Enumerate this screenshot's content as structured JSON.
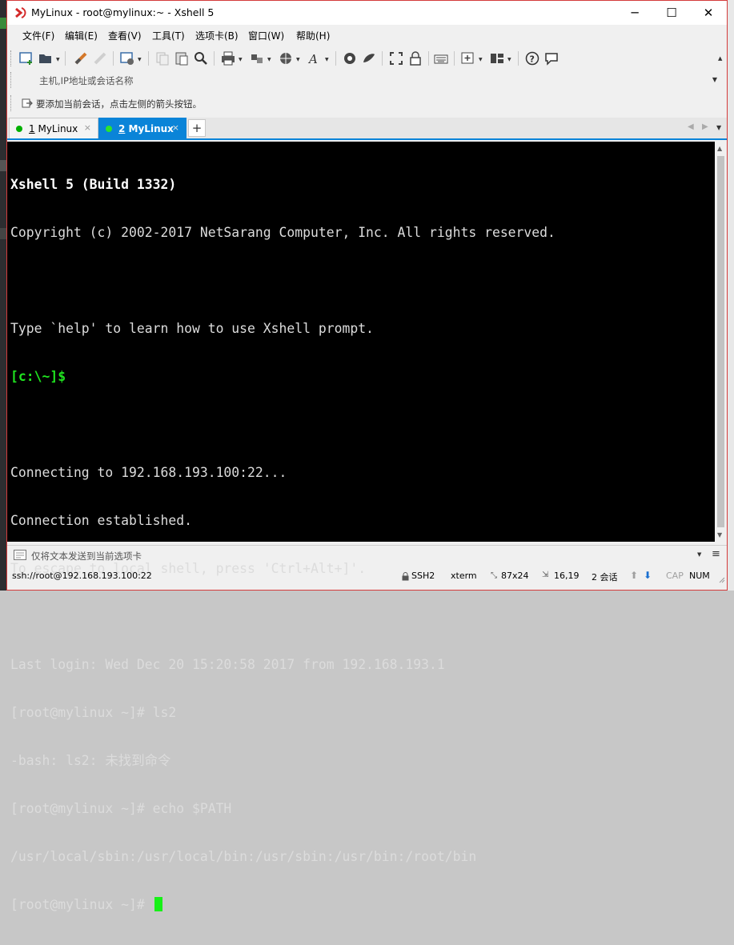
{
  "window": {
    "title": "MyLinux - root@mylinux:~ - Xshell 5",
    "buttons": {
      "minimize": "─",
      "maximize": "☐",
      "close": "✕"
    }
  },
  "menu": [
    "文件(F)",
    "编辑(E)",
    "查看(V)",
    "工具(T)",
    "选项卡(B)",
    "窗口(W)",
    "帮助(H)"
  ],
  "address_bar": {
    "placeholder": "主机,IP地址或会话名称"
  },
  "hint_bar": {
    "text": "要添加当前会话，点击左侧的箭头按钮。"
  },
  "tabs": [
    {
      "number": "1",
      "label": "MyLinux",
      "active": false
    },
    {
      "number": "2",
      "label": "MyLinux",
      "active": true
    }
  ],
  "tab_close": "×",
  "tab_add": "+",
  "terminal": {
    "lines": [
      {
        "text": "Xshell 5 (Build 1332)",
        "style": "bold"
      },
      {
        "text": "Copyright (c) 2002-2017 NetSarang Computer, Inc. All rights reserved.",
        "style": "normal"
      },
      {
        "text": "",
        "style": "normal"
      },
      {
        "text": "Type `help' to learn how to use Xshell prompt.",
        "style": "normal"
      },
      {
        "text": "[c:\\~]$",
        "style": "prompt"
      },
      {
        "text": "",
        "style": "normal"
      },
      {
        "text": "Connecting to 192.168.193.100:22...",
        "style": "normal"
      },
      {
        "text": "Connection established.",
        "style": "normal"
      },
      {
        "text": "To escape to local shell, press 'Ctrl+Alt+]'.",
        "style": "normal"
      },
      {
        "text": "",
        "style": "normal"
      },
      {
        "text": "Last login: Wed Dec 20 15:20:58 2017 from 192.168.193.1",
        "style": "normal"
      },
      {
        "text": "[root@mylinux ~]# ls2",
        "style": "normal"
      },
      {
        "text": "-bash: ls2: 未找到命令",
        "style": "normal"
      },
      {
        "text": "[root@mylinux ~]# echo $PATH",
        "style": "normal"
      },
      {
        "text": "/usr/local/sbin:/usr/local/bin:/usr/sbin:/usr/bin:/root/bin",
        "style": "normal"
      },
      {
        "text": "[root@mylinux ~]# ",
        "style": "normal"
      }
    ],
    "cursor_color": "#17f117"
  },
  "compose_bar": {
    "text": "仅将文本发送到当前选项卡"
  },
  "status": {
    "connection": "ssh://root@192.168.193.100:22",
    "protocol": "SSH2",
    "terminal_type": "xterm",
    "size": "87x24",
    "cursor_pos": "16,19",
    "sessions": "2 会话",
    "caps": "CAP",
    "num": "NUM"
  },
  "colors": {
    "accent": "#0a84d8",
    "window_border": "#d43b3b",
    "terminal_bg": "#000000",
    "prompt_green": "#1fe31f"
  }
}
